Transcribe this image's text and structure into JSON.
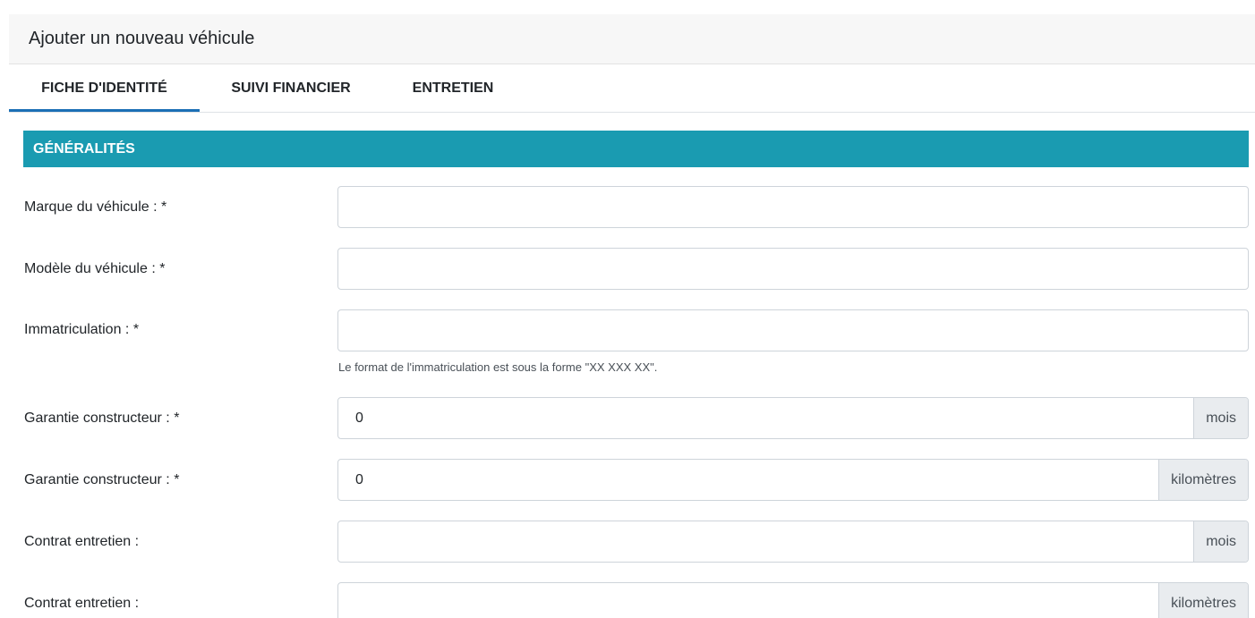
{
  "header": {
    "title": "Ajouter un nouveau véhicule"
  },
  "tabs": [
    {
      "label": "FICHE D'IDENTITÉ",
      "active": true
    },
    {
      "label": "SUIVI FINANCIER",
      "active": false
    },
    {
      "label": "ENTRETIEN",
      "active": false
    }
  ],
  "section": {
    "title": "GÉNÉRALITÉS"
  },
  "fields": {
    "marque": {
      "label": "Marque du véhicule : *",
      "value": ""
    },
    "modele": {
      "label": "Modèle du véhicule : *",
      "value": ""
    },
    "immatriculation": {
      "label": "Immatriculation : *",
      "value": "",
      "help": "Le format de l'immatriculation est sous la forme \"XX XXX XX\"."
    },
    "garantie_mois": {
      "label": "Garantie constructeur : *",
      "value": "0",
      "unit": "mois"
    },
    "garantie_km": {
      "label": "Garantie constructeur : *",
      "value": "0",
      "unit": "kilomètres"
    },
    "contrat_mois": {
      "label": "Contrat entretien :",
      "value": "",
      "unit": "mois"
    },
    "contrat_km": {
      "label": "Contrat entretien :",
      "value": "",
      "unit": "kilomètres"
    }
  },
  "colors": {
    "section_bg": "#1a9bb1",
    "active_tab_underline": "#1b6fb5",
    "header_bg": "#f7f7f7",
    "addon_bg": "#e9ecef"
  }
}
